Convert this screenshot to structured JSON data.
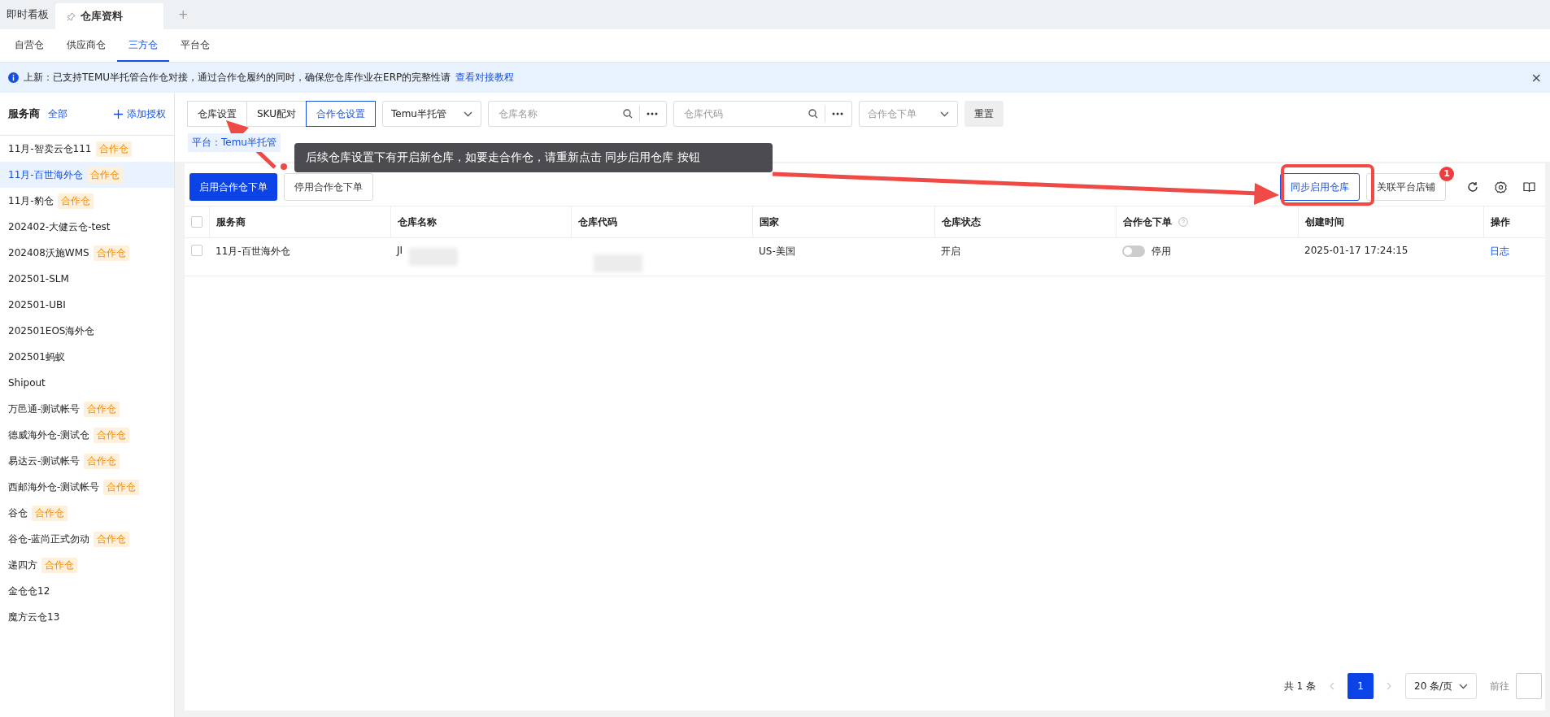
{
  "top_tabs": [
    {
      "label": "即时看板",
      "selected": false,
      "pinned": false
    },
    {
      "label": "仓库资料",
      "selected": true,
      "pinned": true
    }
  ],
  "add_tab": "+",
  "sub_tabs": [
    {
      "label": "自营仓",
      "selected": false
    },
    {
      "label": "供应商仓",
      "selected": false
    },
    {
      "label": "三方仓",
      "selected": true
    },
    {
      "label": "平台仓",
      "selected": false
    }
  ],
  "notice": {
    "text": "上新：已支持TEMU半托管合作仓对接，通过合作仓履约的同时，确保您仓库作业在ERP的完整性请",
    "link": "查看对接教程",
    "close": "×"
  },
  "sidebar": {
    "title": "服务商",
    "all_link": "全部",
    "add_button": "添加授权",
    "items": [
      {
        "name": "11月-智卖云仓111",
        "tag": "合作仓",
        "selected": false
      },
      {
        "name": "11月-百世海外仓",
        "tag": "合作仓",
        "selected": true
      },
      {
        "name": "11月-豹仓",
        "tag": "合作仓",
        "selected": false
      },
      {
        "name": "202402-大健云仓-test",
        "selected": false
      },
      {
        "name": "202408沃施WMS",
        "tag": "合作仓",
        "selected": false
      },
      {
        "name": "202501-SLM",
        "selected": false
      },
      {
        "name": "202501-UBI",
        "selected": false
      },
      {
        "name": "202501EOS海外仓",
        "selected": false
      },
      {
        "name": "202501蚂蚁",
        "selected": false
      },
      {
        "name": "Shipout",
        "selected": false
      },
      {
        "name": "万邑通-测试帐号",
        "tag": "合作仓",
        "selected": false
      },
      {
        "name": "德威海外仓-测试仓",
        "tag": "合作仓",
        "selected": false
      },
      {
        "name": "易达云-测试帐号",
        "tag": "合作仓",
        "selected": false
      },
      {
        "name": "西邮海外仓-测试帐号",
        "tag": "合作仓",
        "selected": false
      },
      {
        "name": "谷仓",
        "tag": "合作仓",
        "selected": false
      },
      {
        "name": "谷仓-蓝尚正式勿动",
        "tag": "合作仓",
        "selected": false
      },
      {
        "name": "递四方",
        "tag": "合作仓",
        "selected": false
      },
      {
        "name": "金仓仓12",
        "selected": false
      },
      {
        "name": "魔方云仓13",
        "selected": false
      }
    ]
  },
  "filters": {
    "segments": [
      {
        "label": "仓库设置",
        "selected": false
      },
      {
        "label": "SKU配对",
        "selected": false
      },
      {
        "label": "合作仓设置",
        "selected": true
      }
    ],
    "platform_select": "Temu半托管",
    "name_search": {
      "placeholder": "仓库名称"
    },
    "code_search": {
      "placeholder": "仓库代码"
    },
    "order_select": {
      "placeholder": "合作仓下单"
    },
    "reset": "重置",
    "platform_tag": "平台：Temu半托管"
  },
  "toolbar": {
    "enable": "启用合作仓下单",
    "disable": "停用合作仓下单",
    "sync": "同步启用仓库",
    "link_store": "关联平台店铺",
    "badge": "1"
  },
  "table": {
    "select_all_checked": false,
    "columns": [
      "服务商",
      "仓库名称",
      "仓库代码",
      "国家",
      "仓库状态",
      "合作仓下单",
      "创建时间",
      "操作"
    ],
    "rows": [
      {
        "checked": false,
        "provider": "11月-百世海外仓",
        "name": "JI",
        "country": "US-美国",
        "status": "开启",
        "order_on": false,
        "order_label": "停用",
        "created": "2025-01-17 17:24:15",
        "action": "日志"
      }
    ]
  },
  "pagination": {
    "total": "共 1 条",
    "pages": [
      {
        "label": "1",
        "selected": true
      }
    ],
    "page_size": "20 条/页",
    "goto": "前往"
  },
  "annotation": {
    "tooltip": "后续仓库设置下有开启新仓库，如要走合作仓，请重新点击 同步启用仓库 按钮"
  }
}
